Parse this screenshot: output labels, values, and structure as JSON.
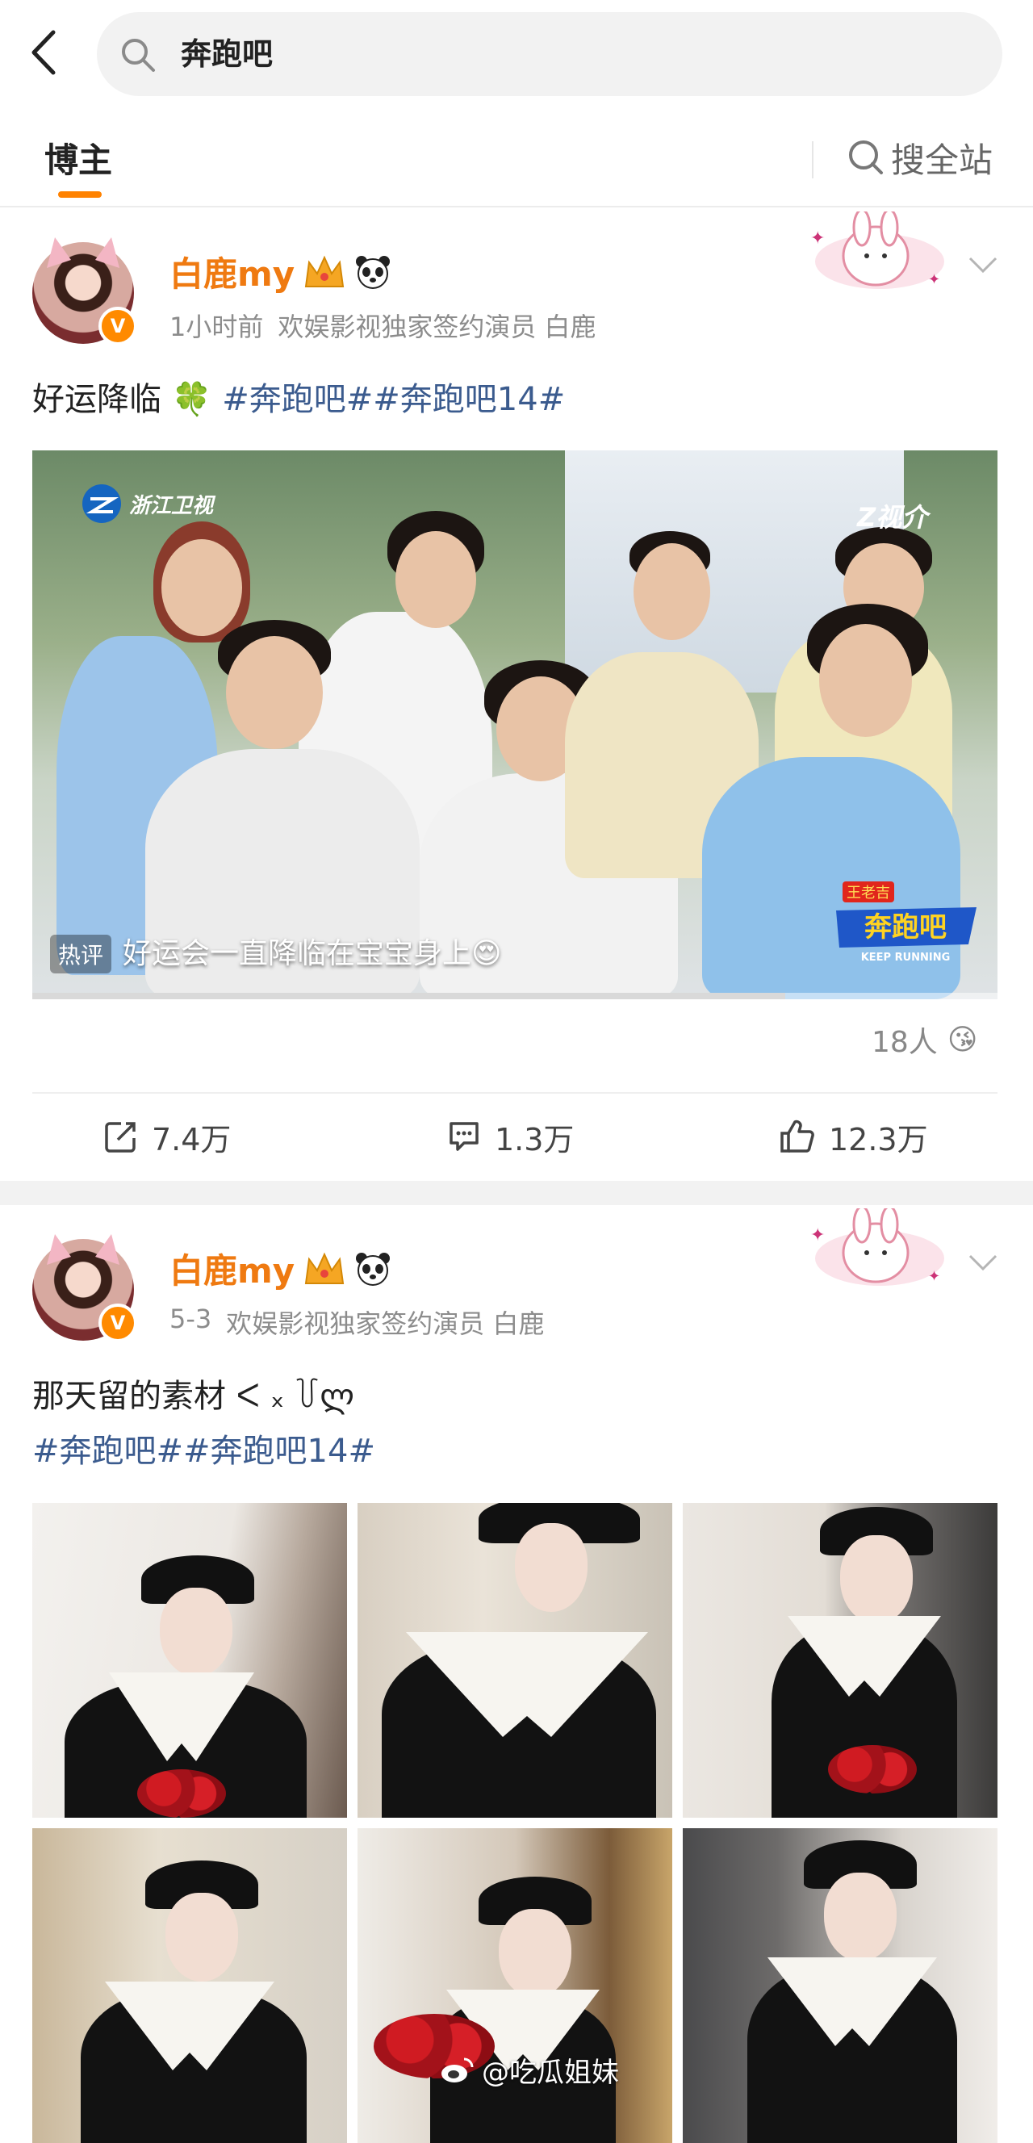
{
  "search": {
    "back_label": "‹",
    "query": "奔跑吧"
  },
  "tabs": {
    "blogger": "博主",
    "search_all": "搜全站"
  },
  "posts": [
    {
      "user_name": "白鹿my",
      "badges": [
        "crown-icon",
        "panda-icon"
      ],
      "time": "1小时前",
      "description": "欢娱影视独家签约演员 白鹿",
      "text": "好运降临",
      "emoji": "🍀",
      "hashtags": "#奔跑吧##奔跑吧14#",
      "video": {
        "channel_logo": "浙江卫视",
        "platform_logo": "Z视介",
        "hot_badge": "热评",
        "hot_comment": "好运会一直降临在宝宝身上😍",
        "show_logo_line1": "王老吉",
        "show_logo_line2": "奔跑吧",
        "show_logo_line3": "KEEP RUNNING",
        "progress": 0.78
      },
      "reaction_count": "18人",
      "reaction_emoji": "😘",
      "shares": "7.4万",
      "comments": "1.3万",
      "likes": "12.3万"
    },
    {
      "user_name": "白鹿my",
      "badges": [
        "crown-icon",
        "panda-icon"
      ],
      "time": "5-3",
      "description": "欢娱影视独家签约演员 白鹿",
      "text": "那天留的素材",
      "kaomoji": "ᐸ ₓ ꒦ლ",
      "hashtags": "#奔跑吧##奔跑吧14#"
    }
  ],
  "watermark": "@吃瓜姐妹",
  "colors": {
    "accent": "#ff8200",
    "username": "#ef7a11",
    "hashtag": "#3b5b8e"
  }
}
